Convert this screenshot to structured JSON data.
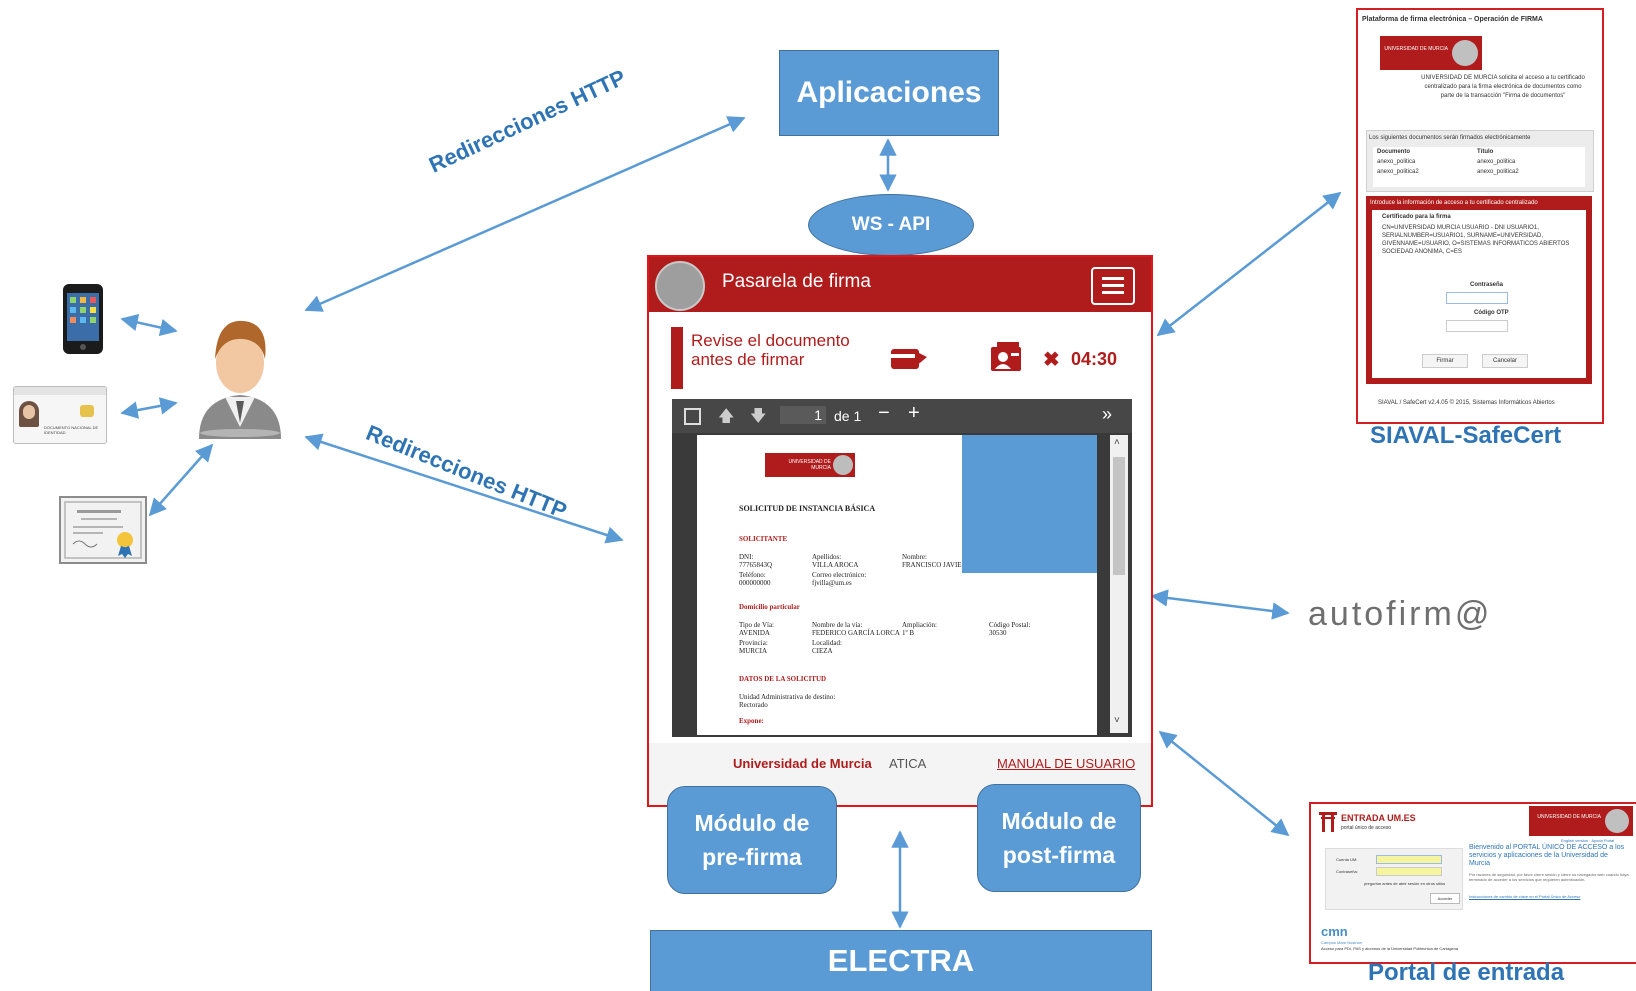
{
  "colors": {
    "accent_blue": "#5b9bd5",
    "arrow_blue": "#5b9bd5",
    "label_blue": "#2e74b5",
    "brand_red": "#b01c1c"
  },
  "labels": {
    "aplicaciones": "Aplicaciones",
    "ws_api": "WS - API",
    "http_top": "Redirecciones HTTP",
    "http_bottom": "Redirecciones HTTP",
    "electra": "ELECTRA",
    "pre_firma": "Módulo de\npre-firma",
    "post_firma": "Módulo de\npost-firma",
    "siaval": "SIAVAL-SafeCert",
    "autofirma": "autofirm@",
    "portal": "Portal de entrada"
  },
  "gateway": {
    "title": "Pasarela de firma",
    "review_text": "Revise el documento antes de firmar",
    "timer": "04:30",
    "viewer": {
      "page_number": "1",
      "page_of": "de 1"
    },
    "document": {
      "logo_text": "UNIVERSIDAD DE MURCIA",
      "heading": "SOLICITUD DE INSTANCIA BÁSICA",
      "section_solicitante": "SOLICITANTE",
      "fields_row1": [
        {
          "label": "DNI:",
          "value": "77765843Q"
        },
        {
          "label": "Apellidos:",
          "value": "VILLA AROCA"
        },
        {
          "label": "Nombre:",
          "value": "FRANCISCO JAVIER"
        }
      ],
      "fields_row2": [
        {
          "label": "Teléfono:",
          "value": "000000000"
        },
        {
          "label": "Correo electrónico:",
          "value": "fjvilla@um.es"
        }
      ],
      "section_domicilio": "Domicilio particular",
      "fields_row3": [
        {
          "label": "Tipo de Vía:",
          "value": "AVENIDA"
        },
        {
          "label": "Nombre de la vía:",
          "value": "FEDERICO GARCÍA LORCA"
        },
        {
          "label": "Ampliación:",
          "value": "1º B"
        },
        {
          "label": "Código Postal:",
          "value": "30530"
        }
      ],
      "fields_row4": [
        {
          "label": "Provincia:",
          "value": "MURCIA"
        },
        {
          "label": "Localidad:",
          "value": "CIEZA"
        }
      ],
      "section_datos": "DATOS DE LA SOLICITUD",
      "unidad_label": "Unidad Administrativa de destino:",
      "unidad_value": "Rectorado",
      "expone": "Expone:"
    },
    "footer": {
      "university": "Universidad de Murcia",
      "atica": "ATICA",
      "manual": "MANUAL DE USUARIO"
    }
  },
  "siaval_panel": {
    "title": "Plataforma de firma electrónica – Operación de FIRMA",
    "logo_text": "UNIVERSIDAD DE MURCIA",
    "intro": "UNIVERSIDAD DE MURCIA solicita el acceso a tu certificado centralizado para la firma electrónica de documentos como parte de la transacción \"Firma de documentos\"",
    "docs_caption": "Los siguientes documentos serán firmados electrónicamente",
    "docs_headers": [
      "Documento",
      "Título"
    ],
    "docs_rows": [
      [
        "anexo_politica",
        "anexo_politica"
      ],
      [
        "anexo_politica2",
        "anexo_politica2"
      ]
    ],
    "access_caption": "Introduce la información de acceso a tu certificado centralizado",
    "cert_label": "Certificado para la firma",
    "cert_value": "CN=UNIVERSIDAD MURCIA USUARIO - DNI USUARIO1, SERIALNUMBER=USUARIO1, SURNAME=UNIVERSIDAD, GIVENNAME=USUARIO, O=SISTEMAS INFORMATICOS ABIERTOS SOCIEDAD ANONIMA, C=ES",
    "password_label": "Contraseña",
    "otp_label": "Código OTP",
    "sign_button": "Firmar",
    "cancel_button": "Cancelar",
    "footer": "SIAVAL / SafeCert v2.4.05 © 2015, Sistemas Informáticos Abiertos"
  },
  "portal_panel": {
    "brand": "ENTRADA UM.ES",
    "brand_sub": "portal único de acceso",
    "logo_text": "UNIVERSIDAD DE MURCIA",
    "links": "English version · Ayuda Portal",
    "welcome": "Bienvenido al PORTAL ÚNICO DE ACCESO a los servicios y aplicaciones de la Universidad de Murcia",
    "notice": "Por razones de seguridad, por favor cierre sesión y cierre su navegador web cuando haya terminado de acceder a los servicios que requieren autenticación.",
    "more_link": "Instrucciones de cambio de clave en el Portal Único de Acceso",
    "user_label": "Cuenta UM:",
    "pass_label": "Contraseña:",
    "remember": "preguntar antes de abrir sesión en otros sitios",
    "access_button": "Acceder",
    "cmn_logo": "cmn",
    "cmn_sub": "Campus Mare Nostrum",
    "cmn_note": "Acceso para PDI, PAS y alumnos de la Universidad Politécnica de Cartagena"
  },
  "id_card": {
    "text": "DOCUMENTO NACIONAL DE IDENTIDAD"
  }
}
